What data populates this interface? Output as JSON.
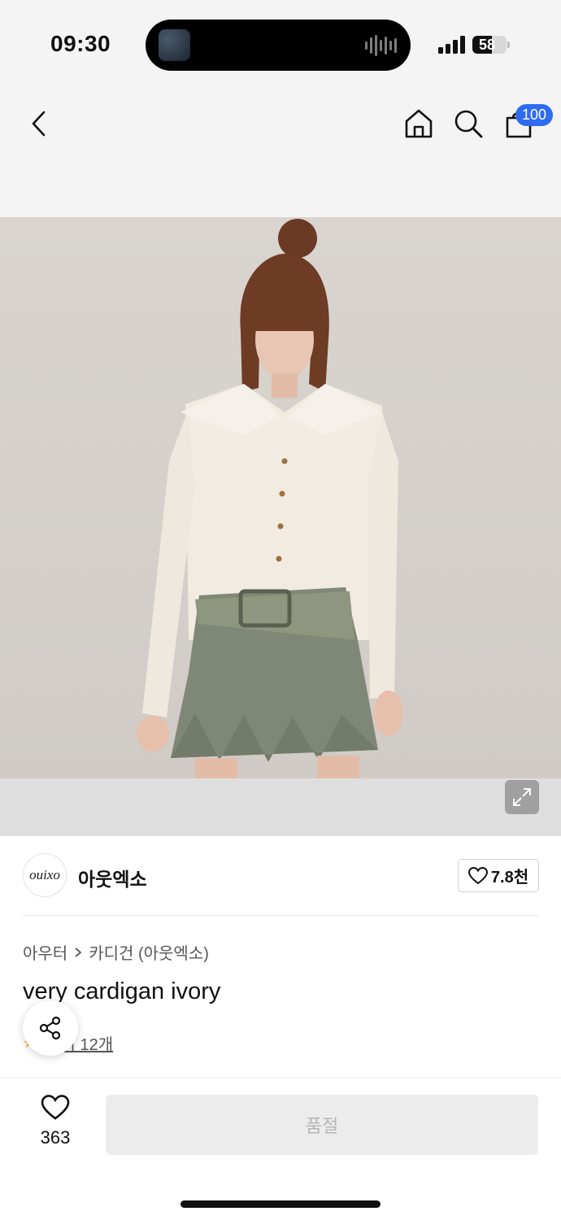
{
  "status_bar": {
    "time": "09:30",
    "battery": "58",
    "battery_level": 0.58
  },
  "nav": {
    "cart_badge": "100"
  },
  "brand": {
    "logo_text": "ouixo",
    "name": "아웃엑소",
    "like_count": "7.8천"
  },
  "product": {
    "breadcrumb": [
      "아우터",
      "카디건 (아웃엑소)"
    ],
    "title": "very cardigan ivory",
    "review_label": "후기 12개"
  },
  "bottom_bar": {
    "wish_count": "363",
    "buy_button_label": "품절"
  },
  "colors": {
    "accent_badge": "#2f6bf1",
    "soldout_bg": "#ececec",
    "soldout_text": "#b6b6b6"
  },
  "icons": [
    "back-arrow-icon",
    "home-icon",
    "search-icon",
    "shopping-bag-icon",
    "expand-icon",
    "heart-icon",
    "share-icon",
    "star-icon"
  ]
}
